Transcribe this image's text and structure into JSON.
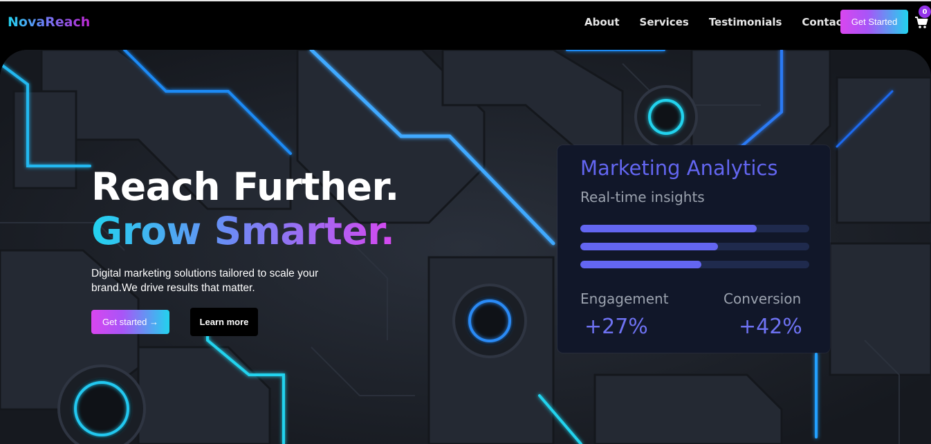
{
  "brand": {
    "name": "NovaReach"
  },
  "nav": {
    "links": [
      "About",
      "Services",
      "Testimonials",
      "Contact"
    ],
    "cta_label": "Get Started",
    "cart_icon": "cart-icon",
    "cart_count": "0"
  },
  "hero": {
    "title_line1": "Reach Further.",
    "title_line2": "Grow Smarter.",
    "subtitle": "Digital marketing solutions tailored to scale your brand.We drive results that matter.",
    "primary_button": "Get started →",
    "secondary_button": "Learn more"
  },
  "analytics_card": {
    "title": "Marketing Analytics",
    "subtitle": "Real-time insights",
    "progress": [
      0.77,
      0.6,
      0.53
    ],
    "metrics": [
      {
        "label": "Engagement",
        "value": "+27%"
      },
      {
        "label": "Conversion",
        "value": "+42%"
      }
    ]
  },
  "colors": {
    "accent_indigo": "#6366f1",
    "accent_cyan": "#22d3ee",
    "accent_magenta": "#d946ef",
    "card_background": "#111729"
  }
}
